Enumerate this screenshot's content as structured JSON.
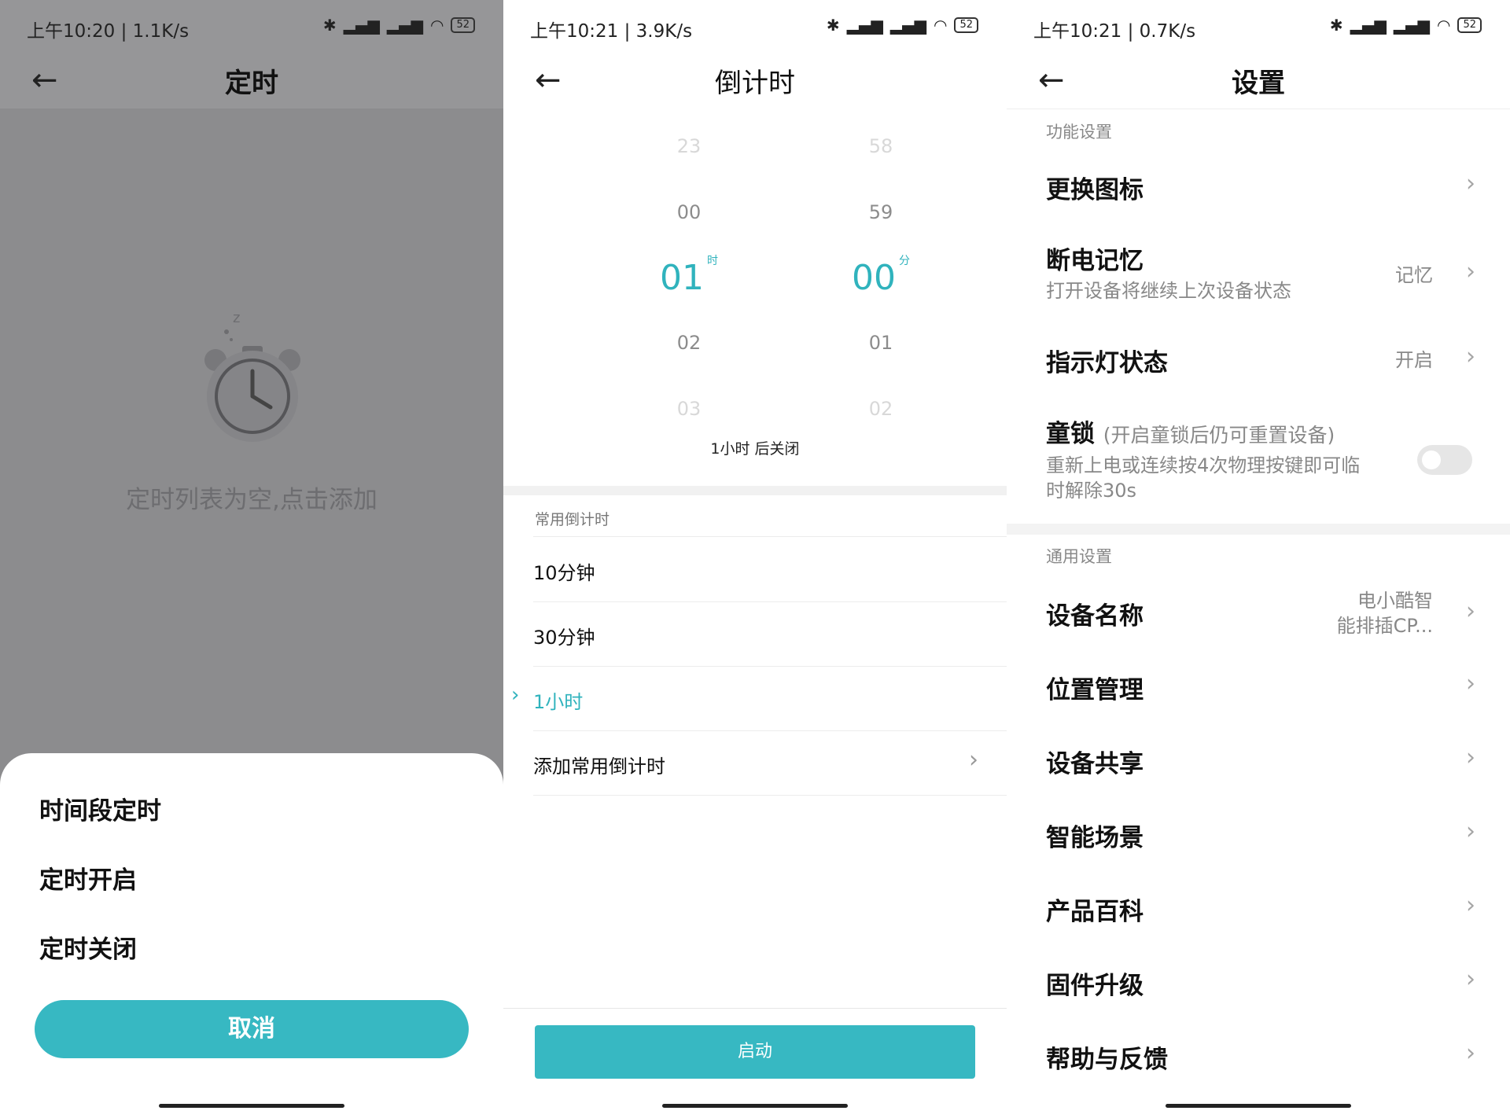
{
  "colors": {
    "accent": "#37b8c2",
    "overlay": "#8c8c8e"
  },
  "panel1": {
    "status": {
      "time": "上午10:20 | 1.1K/s",
      "battery": "52"
    },
    "title": "定时",
    "empty_text": "定时列表为空,点击添加",
    "sheet": {
      "items": [
        "时间段定时",
        "定时开启",
        "定时关闭"
      ],
      "cancel": "取消"
    }
  },
  "panel2": {
    "status": {
      "time": "上午10:21 | 3.9K/s",
      "battery": "52"
    },
    "title": "倒计时",
    "hours": [
      "23",
      "00",
      "01",
      "02",
      "03"
    ],
    "minutes": [
      "58",
      "59",
      "00",
      "01",
      "02"
    ],
    "hour_unit": "时",
    "minute_unit": "分",
    "summary": "1小时 后关闭",
    "common_label": "常用倒计时",
    "presets": [
      "10分钟",
      "30分钟",
      "1小时"
    ],
    "active_preset": 2,
    "add_label": "添加常用倒计时",
    "start": "启动"
  },
  "panel3": {
    "status": {
      "time": "上午10:21 | 0.7K/s",
      "battery": "52"
    },
    "title": "设置",
    "section_function": "功能设置",
    "change_icon": "更换图标",
    "power_memory": {
      "label": "断电记忆",
      "sub": "打开设备将继续上次设备状态",
      "value": "记忆"
    },
    "indicator": {
      "label": "指示灯状态",
      "value": "开启"
    },
    "child_lock": {
      "label": "童锁",
      "note": "(开启童锁后仍可重置设备)",
      "sub1": "重新上电或连续按4次物理按键即可临",
      "sub2": "时解除30s",
      "enabled": false
    },
    "section_general": "通用设置",
    "device_name": {
      "label": "设备名称",
      "value1": "电小酷智",
      "value2": "能排插CP..."
    },
    "general_items": [
      "位置管理",
      "设备共享",
      "智能场景",
      "产品百科",
      "固件升级",
      "帮助与反馈"
    ]
  }
}
